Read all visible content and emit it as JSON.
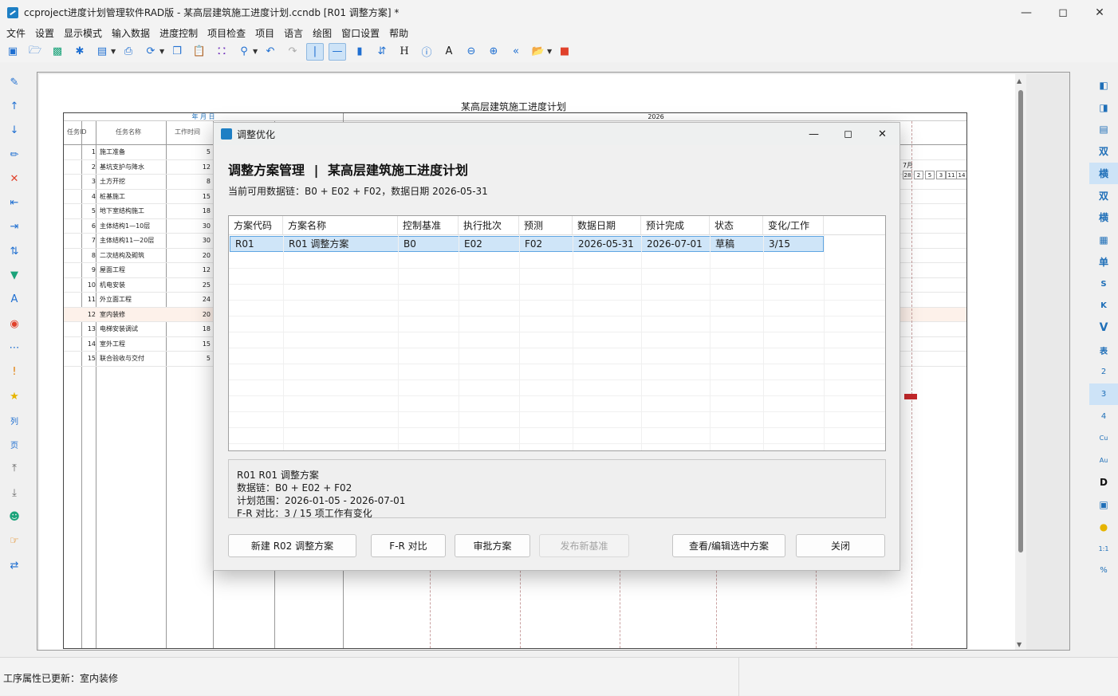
{
  "window": {
    "title": "ccproject进度计划管理软件RAD版 - 某高层建筑施工进度计划.ccndb [R01 调整方案] *"
  },
  "menu": [
    "文件",
    "设置",
    "显示模式",
    "输入数据",
    "进度控制",
    "项目检查",
    "项目",
    "语言",
    "绘图",
    "窗口设置",
    "帮助"
  ],
  "right_toolbar": [
    "双",
    "横",
    "双",
    "横",
    "单",
    "S",
    "K",
    "V",
    "表",
    "2",
    "3",
    "4",
    "Cu",
    "Au",
    "D",
    "1:1",
    "%"
  ],
  "chart": {
    "title": "某高层建筑施工进度计划",
    "header_ym": "年 月 日",
    "header_year": "2026",
    "col_id": "任务ID",
    "col_name": "任务名称",
    "col_duration": "工作时间",
    "month_label": "7月",
    "days": [
      "28",
      "2",
      "5",
      "3",
      "11",
      "14"
    ],
    "tasks": [
      {
        "id": "1",
        "name": "施工准备",
        "duration": "5"
      },
      {
        "id": "2",
        "name": "基坑支护与降水",
        "duration": "12"
      },
      {
        "id": "3",
        "name": "土方开挖",
        "duration": "8"
      },
      {
        "id": "4",
        "name": "桩基施工",
        "duration": "15"
      },
      {
        "id": "5",
        "name": "地下室结构施工",
        "duration": "18"
      },
      {
        "id": "6",
        "name": "主体结构1—10层",
        "duration": "30"
      },
      {
        "id": "7",
        "name": "主体结构11—20层",
        "duration": "30"
      },
      {
        "id": "8",
        "name": "二次结构及砌筑",
        "duration": "20"
      },
      {
        "id": "9",
        "name": "屋面工程",
        "duration": "12"
      },
      {
        "id": "10",
        "name": "机电安装",
        "duration": "25"
      },
      {
        "id": "11",
        "name": "外立面工程",
        "duration": "24"
      },
      {
        "id": "12",
        "name": "室内装修",
        "duration": "20"
      },
      {
        "id": "13",
        "name": "电梯安装调试",
        "duration": "18"
      },
      {
        "id": "14",
        "name": "室外工程",
        "duration": "15"
      },
      {
        "id": "15",
        "name": "联合验收与交付",
        "duration": "5"
      }
    ]
  },
  "dialog": {
    "title": "调整优化",
    "header_left": "调整方案管理",
    "header_sep": "|",
    "header_right": "某高层建筑施工进度计划",
    "subtitle": "当前可用数据链：B0 + E02 + F02，数据日期 2026-05-31",
    "columns": [
      "方案代码",
      "方案名称",
      "控制基准",
      "执行批次",
      "预测",
      "数据日期",
      "预计完成",
      "状态",
      "变化/工作"
    ],
    "rows": [
      [
        "R01",
        "R01 调整方案",
        "B0",
        "E02",
        "F02",
        "2026-05-31",
        "2026-07-01",
        "草稿",
        "3/15"
      ]
    ],
    "detail": {
      "line1": "R01  R01 调整方案",
      "line2": "数据链：B0 + E02 + F02",
      "line3": "计划范围：2026-01-05 - 2026-07-01",
      "line4": "F-R 对比：3 / 15 项工作有变化"
    },
    "buttons": {
      "new": "新建 R02 调整方案",
      "compare": "F-R 对比",
      "approve": "审批方案",
      "publish": "发布新基准",
      "view_edit": "查看/编辑选中方案",
      "close": "关闭"
    }
  },
  "status": {
    "text": "工序属性已更新：室内装修"
  }
}
